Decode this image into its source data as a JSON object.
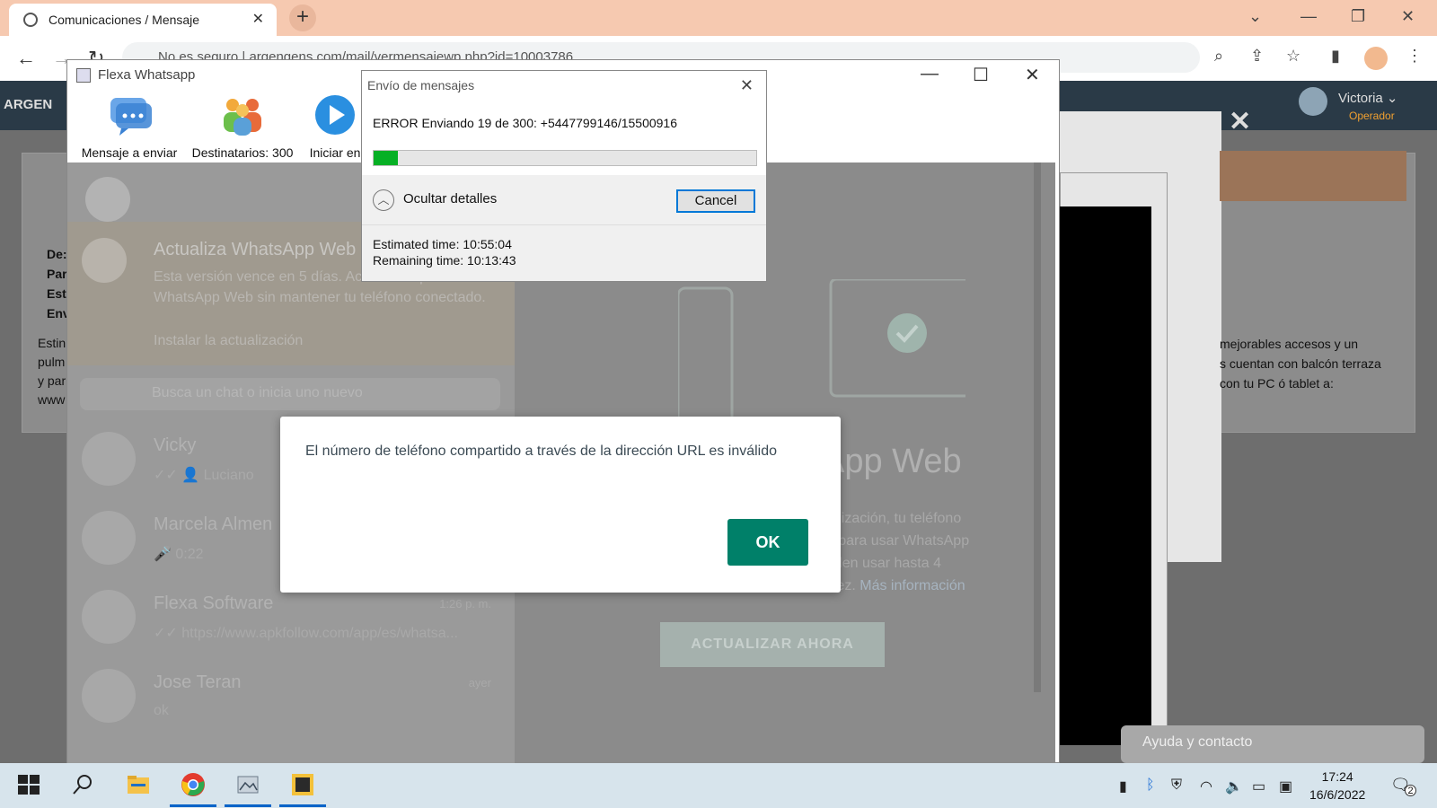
{
  "browser": {
    "tab_title": "Comunicaciones / Mensaje",
    "url": "No es seguro | argengens.com/mail/vermensajewp.php?id=10003786"
  },
  "webapp": {
    "logo": "ARGEN",
    "user_name": "Victoria ⌄",
    "user_role": "Operador",
    "left_labels": [
      "De:",
      "Par",
      "Est",
      "Env"
    ],
    "left_snippet": [
      "Estin",
      "pulm",
      "y par",
      "www"
    ],
    "right_snippet": [
      "mejorables accesos y un",
      "s cuentan con balcón terraza",
      "con tu PC ó tablet a:"
    ],
    "help_label": "Ayuda y contacto"
  },
  "flexa": {
    "title": "Flexa Whatsapp",
    "tools": [
      {
        "label": "Mensaje a enviar",
        "icon": "message-icon"
      },
      {
        "label": "Destinatarios: 300",
        "icon": "recipients-icon"
      },
      {
        "label": "Iniciar en",
        "icon": "play-icon"
      }
    ]
  },
  "whatsapp": {
    "banner_title": "Actualiza WhatsApp Web",
    "banner_text": "Esta versión vence en 5 días. Actualízala para usar WhatsApp Web sin mantener tu teléfono conectado.",
    "banner_link": "Instalar la actualización",
    "search_placeholder": "Busca un chat o inicia uno nuevo",
    "chats": [
      {
        "name": "Vicky",
        "preview": "✓✓ 👤 Luciano",
        "time": ""
      },
      {
        "name": "Marcela Almen",
        "preview": "🎤 0:22",
        "time": ""
      },
      {
        "name": "Flexa Software",
        "preview": "✓✓ https://www.apkfollow.com/app/es/whatsa...",
        "time": "1:26 p. m."
      },
      {
        "name": "Jose Teran",
        "preview": "ok",
        "time": "ayer"
      }
    ],
    "right_title": "App Web",
    "right_text_1": "tualización, tu teléfono",
    "right_text_2": "do para usar WhatsApp",
    "right_text_3": "ueden usar hasta 4",
    "right_text_4": "z vez.",
    "right_link": "Más información",
    "update_button": "ACTUALIZAR AHORA"
  },
  "send_dialog": {
    "title": "Envío de mensajes",
    "message": "ERROR Enviando 19 de 300: +5447799146/15500916",
    "progress_fraction": 0.063,
    "details_label": "Ocultar detalles",
    "cancel_label": "Cancel",
    "estimated": "Estimated time: 10:55:04",
    "remaining": "Remaining time: 10:13:43"
  },
  "error_modal": {
    "text": "El número de teléfono compartido a través de la dirección URL es inválido",
    "ok_label": "OK"
  },
  "taskbar": {
    "time": "17:24",
    "date": "16/6/2022",
    "notification_count": "2"
  },
  "colors": {
    "whatsapp_green": "#008069",
    "progress_green": "#06b025",
    "focus_blue": "#0078d7"
  }
}
